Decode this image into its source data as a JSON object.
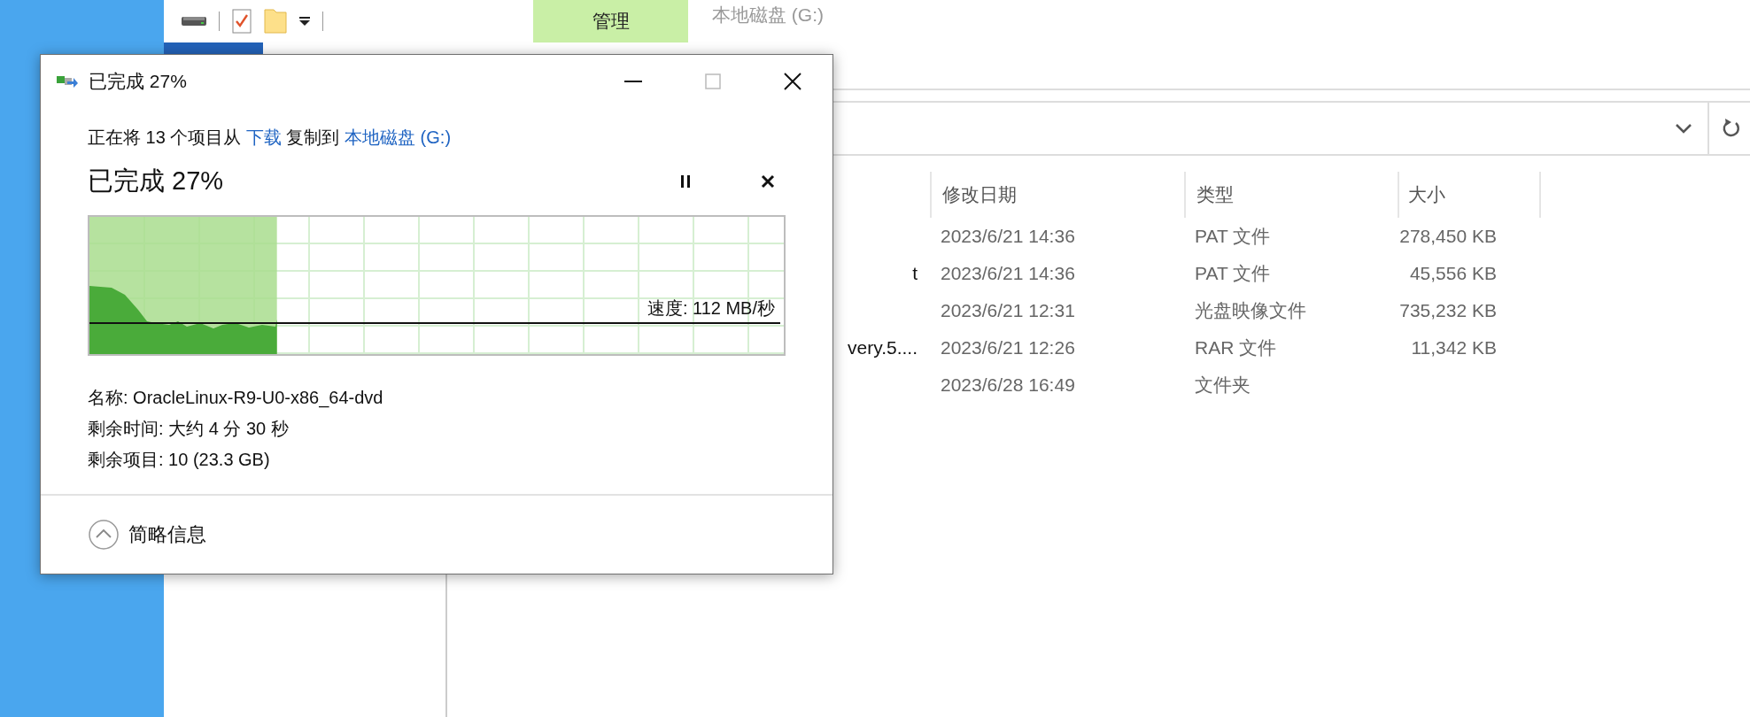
{
  "ribbon": {
    "context_tab": "管理",
    "context_title": "本地磁盘 (G:)"
  },
  "file_list": {
    "columns": [
      "修改日期",
      "类型",
      "大小"
    ],
    "rows": [
      {
        "modified": "2023/6/21 14:36",
        "type": "PAT 文件",
        "size": "278,450 KB"
      },
      {
        "name": "t",
        "modified": "2023/6/21 14:36",
        "type": "PAT 文件",
        "size": "45,556 KB"
      },
      {
        "modified": "2023/6/21 12:31",
        "type": "光盘映像文件",
        "size": "735,232 KB"
      },
      {
        "name": "very.5....",
        "modified": "2023/6/21 12:26",
        "type": "RAR 文件",
        "size": "11,342 KB"
      },
      {
        "modified": "2023/6/28 16:49",
        "type": "文件夹"
      }
    ]
  },
  "copy_dialog": {
    "title": "已完成 27%",
    "summary": {
      "prefix": "正在将 13 个项目从",
      "source": "下载",
      "middle": "复制到",
      "destination": "本地磁盘 (G:)"
    },
    "heading": "已完成 27%",
    "level": 0.27,
    "speed": "速度: 112 MB/秒",
    "details": [
      "名称: OracleLinux-R9-U0-x86_64-dvd",
      "剩余时间: 大约 4 分 30 秒",
      "剩余项目: 10 (23.3 GB)"
    ],
    "toggle": "简略信息"
  }
}
